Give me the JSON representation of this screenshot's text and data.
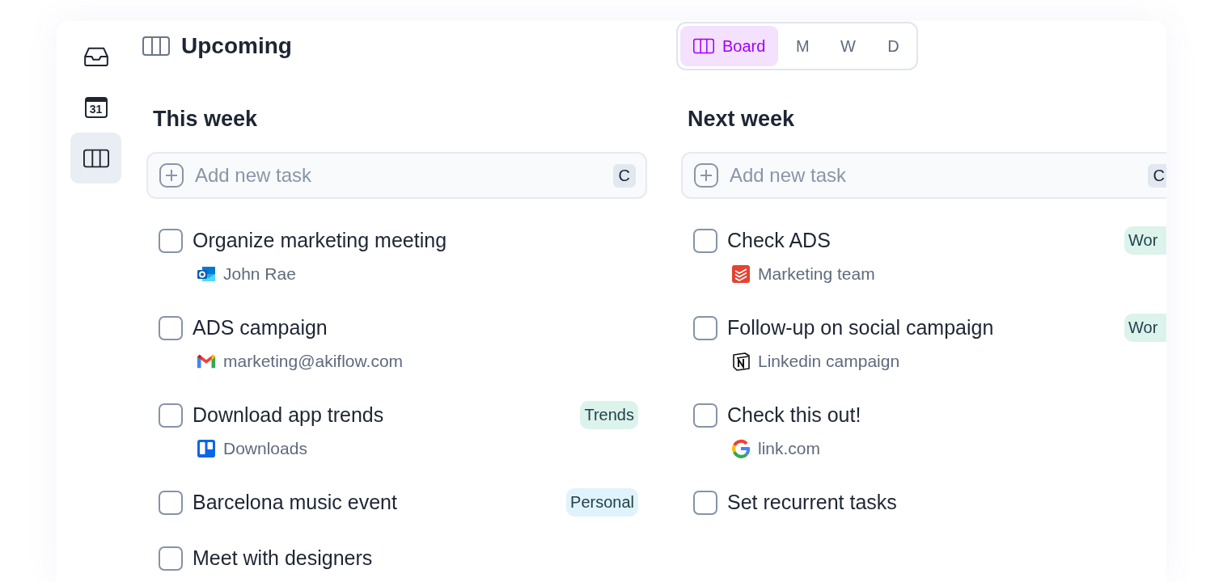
{
  "sidebar": {
    "items": [
      {
        "kind": "inbox",
        "selected": false
      },
      {
        "kind": "calendar",
        "label": "31",
        "selected": false
      },
      {
        "kind": "board",
        "selected": true
      }
    ]
  },
  "header": {
    "title": "Upcoming"
  },
  "view_switch": [
    {
      "kind": "board",
      "label": "Board",
      "selected": true
    },
    {
      "kind": "letter",
      "label": "M",
      "selected": false
    },
    {
      "kind": "letter",
      "label": "W",
      "selected": false
    },
    {
      "kind": "letter",
      "label": "D",
      "selected": false
    }
  ],
  "columns": [
    {
      "title": "This week",
      "add_task": {
        "placeholder": "Add new task",
        "shortcut": "C"
      },
      "tasks": [
        {
          "title": "Organize marketing meeting",
          "checked": false,
          "source": {
            "kind": "outlook",
            "label": "John Rae"
          }
        },
        {
          "title": "ADS campaign",
          "checked": false,
          "source": {
            "kind": "gmail",
            "label": "marketing@akiflow.com"
          }
        },
        {
          "title": "Download app trends",
          "checked": false,
          "source": {
            "kind": "trello",
            "label": "Downloads"
          },
          "tag": {
            "label": "Trends",
            "color": "#dcf3ec"
          }
        },
        {
          "title": "Barcelona music event",
          "checked": false,
          "tag": {
            "label": "Personal",
            "color": "#e0f3fd"
          }
        },
        {
          "title": "Meet with designers",
          "checked": false
        }
      ]
    },
    {
      "title": "Next week",
      "add_task": {
        "placeholder": "Add new task",
        "shortcut": "C"
      },
      "tasks": [
        {
          "title": "Check ADS",
          "checked": false,
          "source": {
            "kind": "todoist",
            "label": "Marketing team"
          },
          "tag": {
            "label": "Wor",
            "color": "#dcf3ec"
          }
        },
        {
          "title": "Follow-up on social campaign",
          "checked": false,
          "source": {
            "kind": "notion",
            "label": "Linkedin campaign"
          },
          "tag": {
            "label": "Wor",
            "color": "#dcf3ec"
          }
        },
        {
          "title": "Check this out!",
          "checked": false,
          "source": {
            "kind": "google",
            "label": "link.com"
          }
        },
        {
          "title": "Set recurrent tasks",
          "checked": false
        }
      ]
    }
  ]
}
